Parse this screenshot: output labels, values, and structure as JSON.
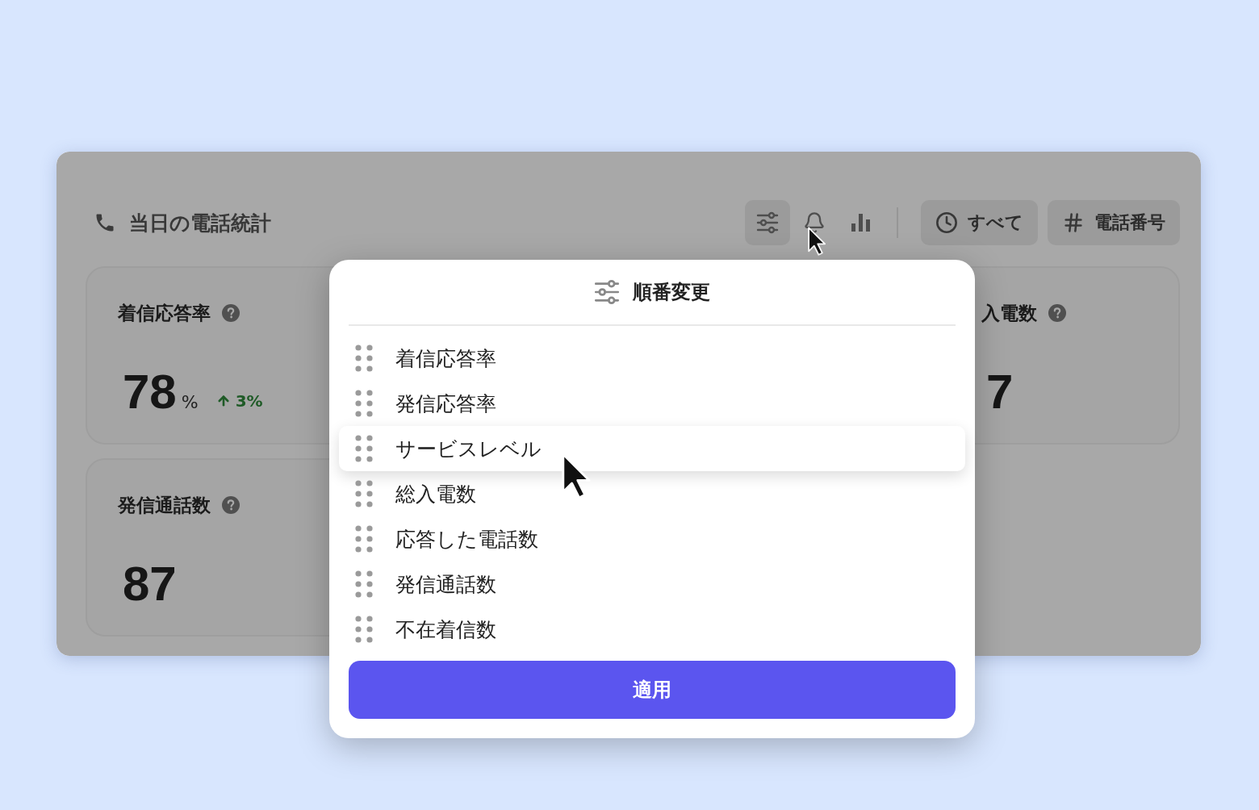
{
  "header": {
    "title": "当日の電話統計",
    "tools": [
      {
        "kind": "sliders",
        "selected": true
      },
      {
        "kind": "bell",
        "selected": false
      },
      {
        "kind": "chart",
        "selected": false
      }
    ],
    "filters": [
      {
        "kind": "clock",
        "label": "すべて"
      },
      {
        "kind": "hash",
        "label": "電話番号"
      }
    ]
  },
  "card_columns": {
    "left": [
      {
        "title": "着信応答率",
        "value": "78",
        "unit": "%",
        "change": "3%"
      },
      {
        "title": "発信通話数",
        "value": "87"
      }
    ],
    "right": [
      {
        "title": "入電数",
        "value": "7"
      }
    ]
  },
  "dialog": {
    "title": "順番変更",
    "items": [
      {
        "label": "着信応答率",
        "dragging": false
      },
      {
        "label": "発信応答率",
        "dragging": false
      },
      {
        "label": "サービスレベル",
        "dragging": true
      },
      {
        "label": "総入電数",
        "dragging": false
      },
      {
        "label": "応答した電話数",
        "dragging": false
      },
      {
        "label": "発信通話数",
        "dragging": false
      },
      {
        "label": "不在着信数",
        "dragging": false
      }
    ],
    "apply_label": "適用"
  }
}
